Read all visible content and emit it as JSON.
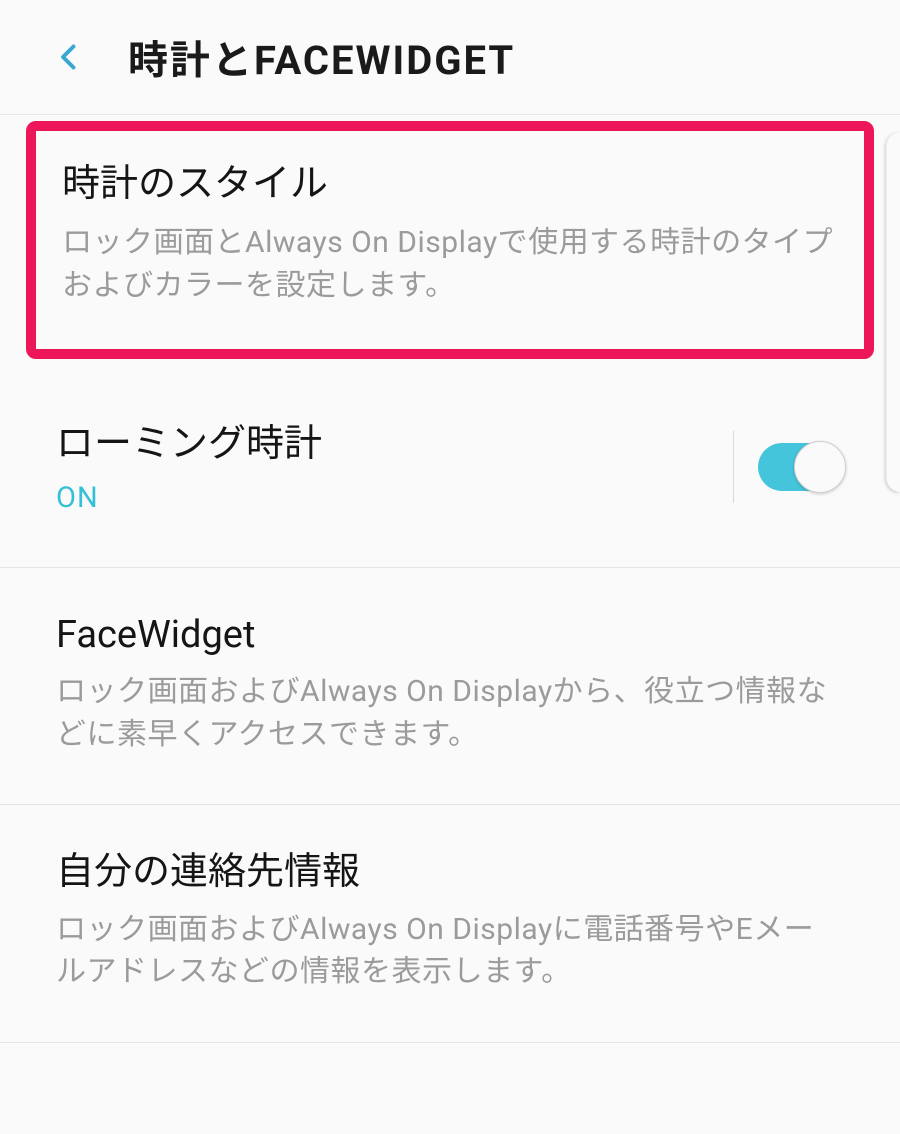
{
  "header": {
    "title": "時計とFACEWIDGET"
  },
  "items": {
    "clock_style": {
      "title": "時計のスタイル",
      "desc": "ロック画面とAlways On Displayで使用する時計のタイプおよびカラーを設定します。"
    },
    "roaming_clock": {
      "title": "ローミング時計",
      "status": "ON"
    },
    "face_widget": {
      "title": "FaceWidget",
      "desc": "ロック画面およびAlways On Displayから、役立つ情報などに素早くアクセスできます。"
    },
    "contact_info": {
      "title": "自分の連絡先情報",
      "desc": "ロック画面およびAlways On Displayに電話番号やEメールアドレスなどの情報を表示します。"
    }
  }
}
